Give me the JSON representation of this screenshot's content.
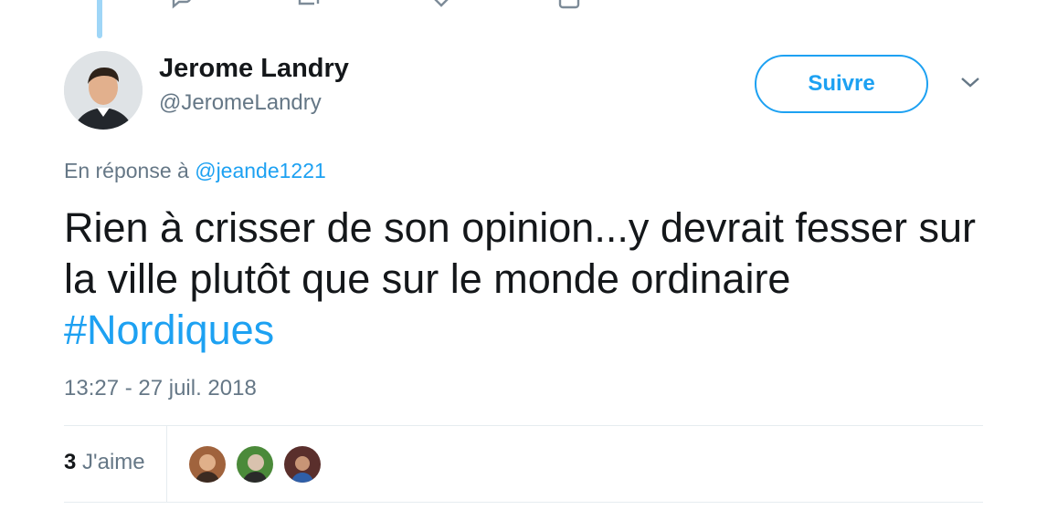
{
  "tweet": {
    "author": {
      "name": "Jerome Landry",
      "handle": "@JeromeLandry"
    },
    "follow_label": "Suivre",
    "reply_prefix": "En réponse à",
    "reply_mention": "@jeande1221",
    "text_main": "Rien à crisser de son opinion...y devrait fesser sur la ville plutôt que sur le monde ordinaire",
    "hashtag": "#Nordiques",
    "timestamp": "13:27 - 27 juil. 2018",
    "likes_count": "3",
    "likes_label": "J'aime"
  },
  "colors": {
    "accent": "#1da1f2",
    "muted": "#657786",
    "text": "#14171a",
    "divider": "#e6ecf0"
  },
  "icons": [
    "reply-icon",
    "retweet-icon",
    "heart-icon",
    "dm-icon",
    "chevron-down-icon"
  ]
}
